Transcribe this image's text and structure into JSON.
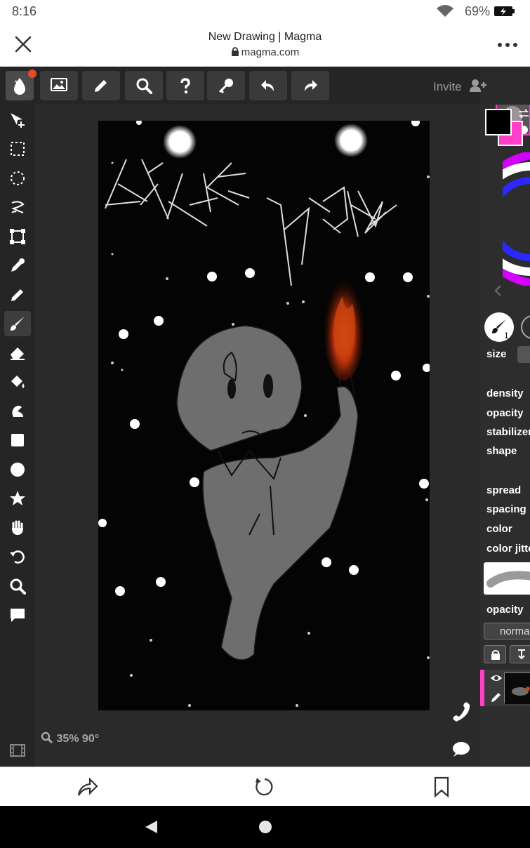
{
  "status_bar": {
    "time": "8:16",
    "battery_percent": "69%"
  },
  "browser": {
    "page_title": "New Drawing | Magma",
    "url": "magma.com"
  },
  "toolbar": {
    "invite_label": "Invite"
  },
  "canvas": {
    "zoom_readout": "35% 90°"
  },
  "brush_panel": {
    "brush_badge": "1",
    "labels": [
      "size",
      "density",
      "opacity",
      "stabilizer",
      "shape",
      "spread",
      "spacing",
      "color",
      "color jitte"
    ],
    "layer_opacity_label": "opacity",
    "blend_mode": "norma"
  },
  "colors": {
    "app_bg": "#2a2a2a",
    "toolbar_bg": "#252525",
    "button_bg": "#3a3a3a",
    "primary_color": "#000000",
    "secondary_color": "#ff3fc8",
    "notification_dot": "#e84a2a"
  },
  "icons": {
    "toolbar": [
      "magma-logo-icon",
      "image-icon",
      "pencil-icon",
      "search-icon",
      "help-icon",
      "key-icon",
      "undo-icon",
      "redo-icon",
      "add-user-icon"
    ],
    "tools": [
      "move-icon",
      "rect-select-icon",
      "ellipse-select-icon",
      "lasso-icon",
      "transform-icon",
      "eyedropper-icon",
      "pencil-tool-icon",
      "brush-icon",
      "eraser-icon",
      "fill-icon",
      "smudge-icon",
      "rectangle-icon",
      "circle-icon",
      "star-icon",
      "hand-icon",
      "rotate-icon",
      "zoom-icon",
      "comment-icon"
    ]
  }
}
